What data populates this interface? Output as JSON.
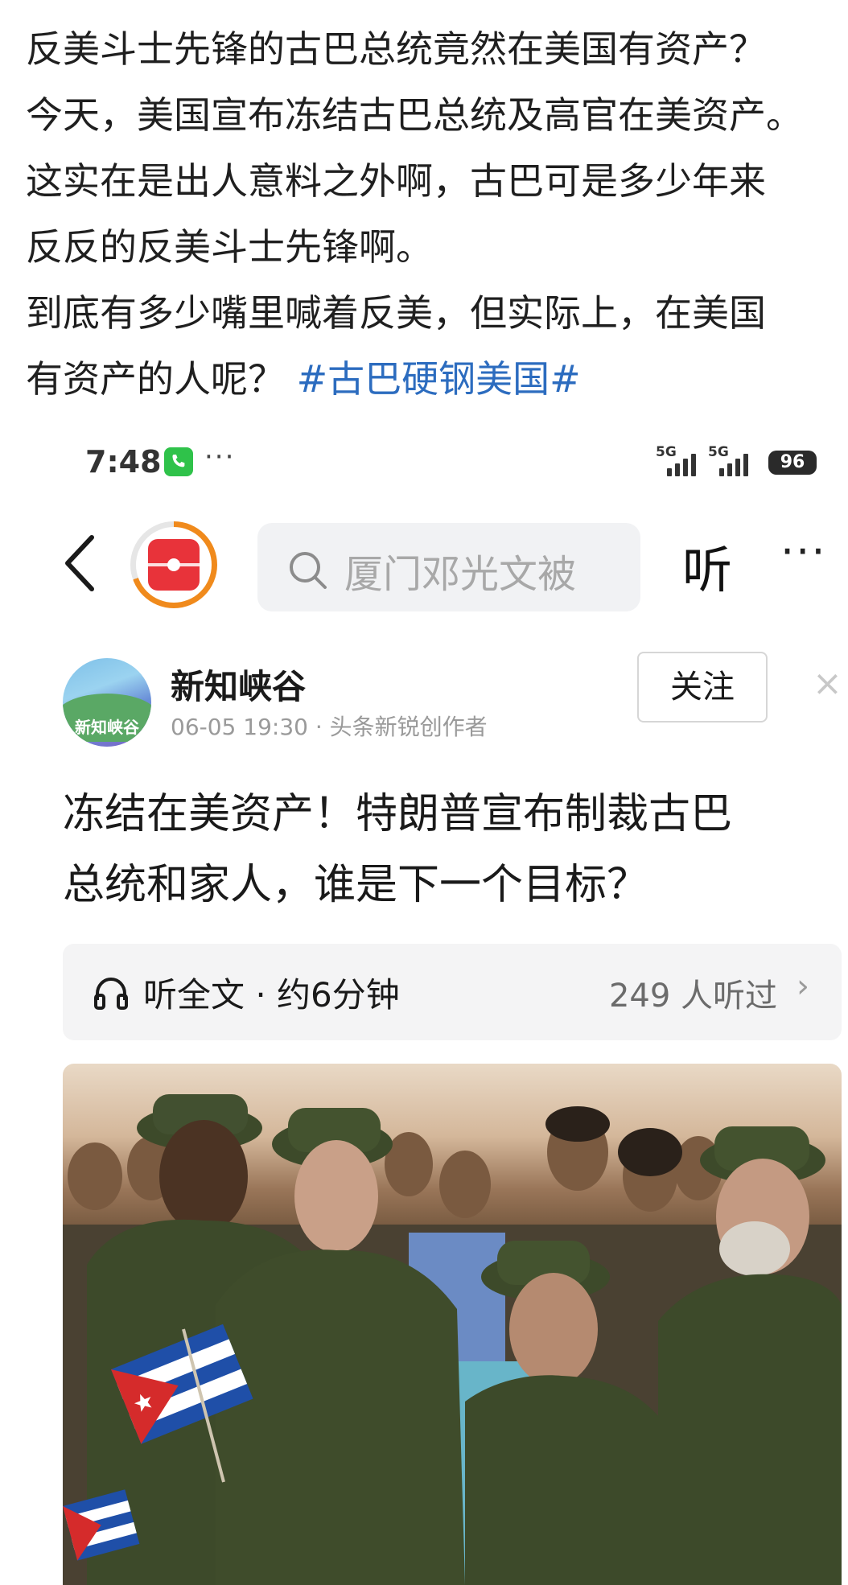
{
  "post": {
    "lines": [
      "反美斗士先锋的古巴总统竟然在美国有资产？",
      "今天，美国宣布冻结古巴总统及高官在美资产。",
      "这实在是出人意料之外啊，古巴可是多少年来",
      "反反的反美斗士先锋啊。",
      "到底有多少嘴里喊着反美，但实际上，在美国"
    ],
    "last_line_text": "有资产的人呢？",
    "hashtag": "#古巴硬钢美国#"
  },
  "status_bar": {
    "time": "7:48",
    "dots": "···",
    "signal1_label": "5G",
    "signal2_label": "5G",
    "battery": "96"
  },
  "nav": {
    "search_placeholder": "厦门邓光文被",
    "listen_label": "听",
    "more_label": "···"
  },
  "author": {
    "name": "新知峡谷",
    "avatar_text": "新知峡谷",
    "meta": "06-05 19:30 · 头条新锐创作者",
    "follow_label": "关注",
    "close_label": "×"
  },
  "article": {
    "title_lines": [
      "冻结在美资产！特朗普宣布制裁古巴",
      "总统和家人，谁是下一个目标？"
    ]
  },
  "listen_card": {
    "label": "听全文 · 约6分钟",
    "count": "249 人听过",
    "chevron": "›"
  },
  "photo": {
    "alt": "古巴领导人身穿军装站在人群中"
  },
  "colors": {
    "hashtag": "#2c6cbf",
    "logo_ring": "#f08a1c",
    "logo_red": "#e8333a",
    "uniform_green": "#3d4a2a"
  }
}
